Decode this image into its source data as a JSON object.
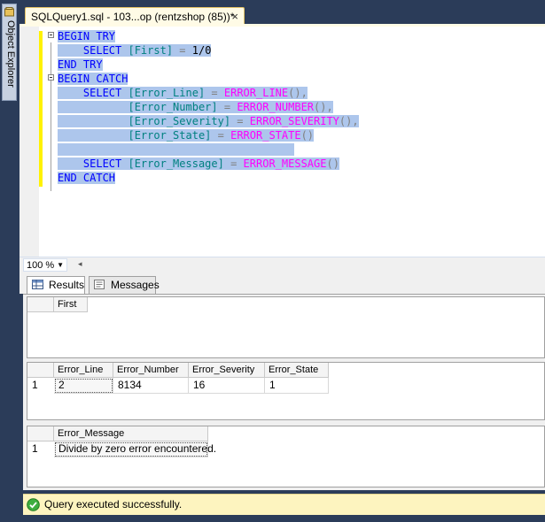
{
  "left_dock": {
    "object_explorer_label": "Object Explorer"
  },
  "document_tab": {
    "title": "SQLQuery1.sql - 103...op (rentzshop (85))*",
    "close_glyph": "×"
  },
  "editor": {
    "lines": [
      {
        "tokens": [
          {
            "t": "BEGIN TRY",
            "c": "kw"
          }
        ]
      },
      {
        "tokens": [
          {
            "t": "    SELECT ",
            "c": "kw"
          },
          {
            "t": "[First]",
            "c": "id"
          },
          {
            "t": " = ",
            "c": "op"
          },
          {
            "t": "1/0",
            "c": "num"
          }
        ]
      },
      {
        "tokens": [
          {
            "t": "END TRY",
            "c": "kw"
          }
        ]
      },
      {
        "tokens": [
          {
            "t": "BEGIN CATCH",
            "c": "kw"
          }
        ]
      },
      {
        "tokens": [
          {
            "t": "    SELECT ",
            "c": "kw"
          },
          {
            "t": "[Error_Line]",
            "c": "id"
          },
          {
            "t": " = ",
            "c": "op"
          },
          {
            "t": "ERROR_LINE",
            "c": "fn"
          },
          {
            "t": "(),",
            "c": "op"
          }
        ]
      },
      {
        "tokens": [
          {
            "t": "           ",
            "c": "kw"
          },
          {
            "t": "[Error_Number]",
            "c": "id"
          },
          {
            "t": " = ",
            "c": "op"
          },
          {
            "t": "ERROR_NUMBER",
            "c": "fn"
          },
          {
            "t": "(),",
            "c": "op"
          }
        ]
      },
      {
        "tokens": [
          {
            "t": "           ",
            "c": "kw"
          },
          {
            "t": "[Error_Severity]",
            "c": "id"
          },
          {
            "t": " = ",
            "c": "op"
          },
          {
            "t": "ERROR_SEVERITY",
            "c": "fn"
          },
          {
            "t": "(),",
            "c": "op"
          }
        ]
      },
      {
        "tokens": [
          {
            "t": "           ",
            "c": "kw"
          },
          {
            "t": "[Error_State]",
            "c": "id"
          },
          {
            "t": " = ",
            "c": "op"
          },
          {
            "t": "ERROR_STATE",
            "c": "fn"
          },
          {
            "t": "()",
            "c": "op"
          }
        ]
      },
      {
        "tokens": [
          {
            "t": "                                     ",
            "c": "kw"
          }
        ]
      },
      {
        "tokens": [
          {
            "t": "    SELECT ",
            "c": "kw"
          },
          {
            "t": "[Error_Message]",
            "c": "id"
          },
          {
            "t": " = ",
            "c": "op"
          },
          {
            "t": "ERROR_MESSAGE",
            "c": "fn"
          },
          {
            "t": "()",
            "c": "op"
          }
        ]
      },
      {
        "tokens": [
          {
            "t": "END CATCH",
            "c": "kw"
          }
        ]
      }
    ]
  },
  "zoom": {
    "value": "100 %"
  },
  "results_tabs": {
    "results": "Results",
    "messages": "Messages"
  },
  "grid1": {
    "headers": [
      "First"
    ],
    "rows": []
  },
  "grid2": {
    "headers": [
      "Error_Line",
      "Error_Number",
      "Error_Severity",
      "Error_State"
    ],
    "rows": [
      {
        "num": "1",
        "cells": [
          "2",
          "8134",
          "16",
          "1"
        ]
      }
    ]
  },
  "grid3": {
    "headers": [
      "Error_Message"
    ],
    "rows": [
      {
        "num": "1",
        "cells": [
          "Divide by zero error encountered."
        ]
      }
    ]
  },
  "status": {
    "text": "Query executed successfully."
  },
  "colors": {
    "selection": "#adc6ec",
    "keyword": "#0000ff",
    "function": "#ff00ff",
    "identifier": "#008080",
    "status_bg": "#fdf4bf",
    "chrome": "#2b3c59"
  }
}
